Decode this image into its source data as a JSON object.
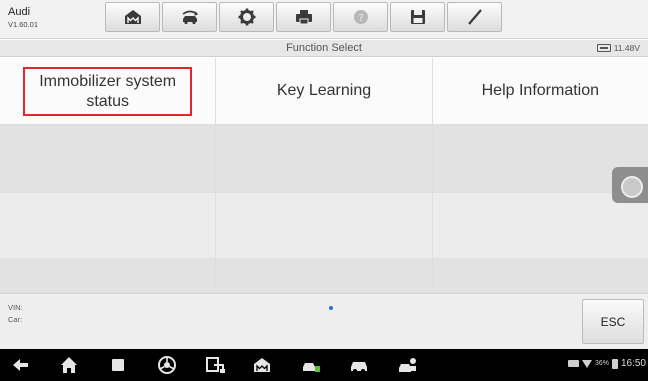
{
  "header": {
    "make": "Audi",
    "version": "V1.60.01",
    "toolbar": [
      {
        "icon": "home-icon"
      },
      {
        "icon": "vehicle-swap-icon"
      },
      {
        "icon": "settings-icon"
      },
      {
        "icon": "print-icon"
      },
      {
        "icon": "help-icon"
      },
      {
        "icon": "save-icon"
      },
      {
        "icon": "edit-icon"
      }
    ]
  },
  "titlebar": {
    "title": "Function Select",
    "voltage": "11.48V"
  },
  "functions": {
    "item1": "Immobilizer system status",
    "item1_line1": "Immobilizer system",
    "item1_line2": "status",
    "item2": "Key Learning",
    "item3": "Help Information"
  },
  "info": {
    "vin_label": "VIN:",
    "car_label": "Car:",
    "esc_label": "ESC"
  },
  "statusbar": {
    "battery_percent": "36%",
    "time": "16:50"
  },
  "colors": {
    "selection_border": "#e0262e",
    "page_indicator": "#2a6fc9"
  }
}
